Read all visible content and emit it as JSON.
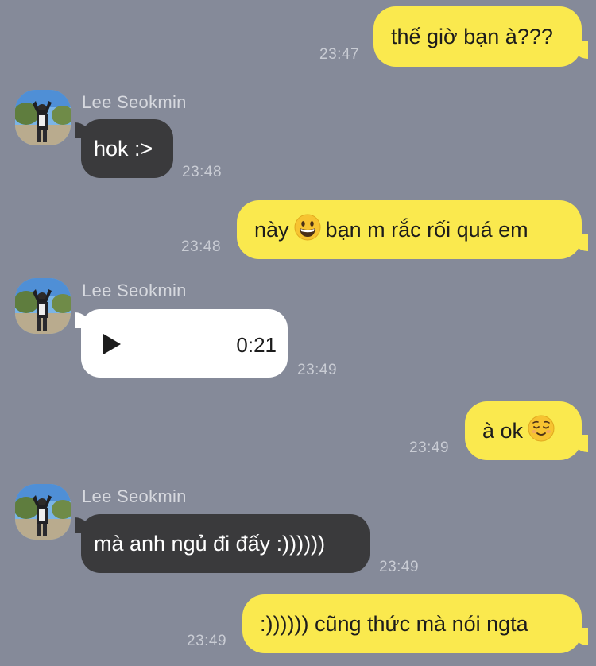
{
  "contact": {
    "name": "Lee Seokmin"
  },
  "messages": [
    {
      "dir": "out",
      "text": "thế giờ bạn à???",
      "time": "23:47"
    },
    {
      "dir": "in",
      "sender": "Lee Seokmin",
      "text": "hok :>",
      "time": "23:48"
    },
    {
      "dir": "out",
      "text_before": "này",
      "emoji": "grinning-face-emoji",
      "text_after": "bạn m rắc rối quá em",
      "time": "23:48"
    },
    {
      "dir": "in",
      "sender": "Lee Seokmin",
      "type": "voice",
      "duration": "0:21",
      "time": "23:49"
    },
    {
      "dir": "out",
      "text": "à ok",
      "emoji": "relieved-face-emoji",
      "time": "23:49"
    },
    {
      "dir": "in",
      "sender": "Lee Seokmin",
      "text": "mà anh ngủ đi đấy :))))))",
      "time": "23:49"
    },
    {
      "dir": "out",
      "text": ":)))))) cũng thức mà nói ngta",
      "time": "23:49"
    }
  ],
  "colors": {
    "background": "#858a99",
    "outgoing_bubble": "#fae94e",
    "incoming_bubble": "#3a3a3c",
    "voice_bubble": "#ffffff",
    "timestamp": "#c9ccd4"
  }
}
